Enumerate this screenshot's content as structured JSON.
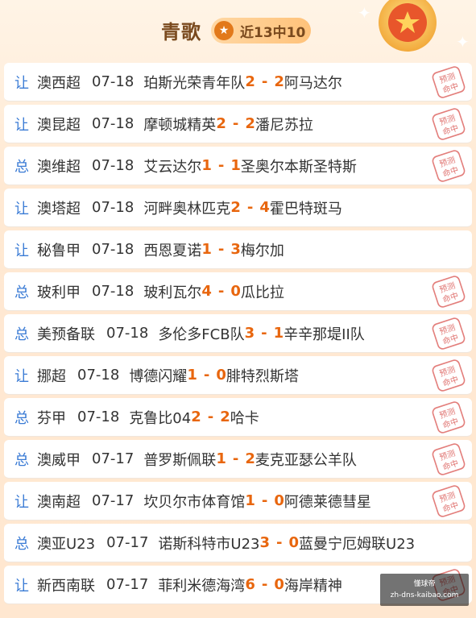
{
  "header": {
    "title": "青歌",
    "record": "近13中10"
  },
  "stamp_text": [
    "预测",
    "命中"
  ],
  "watermark": {
    "line1": "懂球帝",
    "line2": "zh-dns-kaibao.com"
  },
  "colors": {
    "accent": "#e8660e",
    "tag_blue": "#3a7bd5",
    "stamp_red": "#d9534f"
  },
  "matches": [
    {
      "tag": "让",
      "league": "澳西超",
      "date": "07-18",
      "home": "珀斯光荣青年队",
      "home_score": "2",
      "sep": "-",
      "away_score": "2",
      "away": "阿马达尔",
      "hit": true
    },
    {
      "tag": "让",
      "league": "澳昆超",
      "date": "07-18",
      "home": "摩顿城精英",
      "home_score": "2",
      "sep": "-",
      "away_score": "2",
      "away": "潘尼苏拉",
      "hit": true
    },
    {
      "tag": "总",
      "league": "澳维超",
      "date": "07-18",
      "home": "艾云达尔",
      "home_score": "1",
      "sep": "-",
      "away_score": "1",
      "away": "圣奥尔本斯圣特斯",
      "hit": true
    },
    {
      "tag": "让",
      "league": "澳塔超",
      "date": "07-18",
      "home": "河畔奥林匹克",
      "home_score": "2",
      "sep": "-",
      "away_score": "4",
      "away": "霍巴特斑马",
      "hit": false
    },
    {
      "tag": "让",
      "league": "秘鲁甲",
      "date": "07-18",
      "home": "西恩夏诺",
      "home_score": "1",
      "sep": "-",
      "away_score": "3",
      "away": "梅尔加",
      "hit": false
    },
    {
      "tag": "总",
      "league": "玻利甲",
      "date": "07-18",
      "home": "玻利瓦尔",
      "home_score": "4",
      "sep": "-",
      "away_score": "0",
      "away": "瓜比拉",
      "hit": true
    },
    {
      "tag": "总",
      "league": "美预备联",
      "date": "07-18",
      "home": "多伦多FCB队",
      "home_score": "3",
      "sep": "-",
      "away_score": "1",
      "away": "辛辛那堤II队",
      "hit": true
    },
    {
      "tag": "让",
      "league": "挪超",
      "date": "07-18",
      "home": "博德闪耀",
      "home_score": "1",
      "sep": "-",
      "away_score": "0",
      "away": "腓特烈斯塔",
      "hit": true
    },
    {
      "tag": "总",
      "league": "芬甲",
      "date": "07-18",
      "home": "克鲁比04",
      "home_score": "2",
      "sep": "-",
      "away_score": "2",
      "away": "哈卡",
      "hit": true
    },
    {
      "tag": "总",
      "league": "澳威甲",
      "date": "07-17",
      "home": "普罗斯佩联",
      "home_score": "1",
      "sep": "-",
      "away_score": "2",
      "away": "麦克亚瑟公羊队",
      "hit": true
    },
    {
      "tag": "让",
      "league": "澳南超",
      "date": "07-17",
      "home": "坎贝尔市体育馆",
      "home_score": "1",
      "sep": "-",
      "away_score": "0",
      "away": "阿德莱德彗星",
      "hit": true
    },
    {
      "tag": "总",
      "league": "澳亚U23",
      "date": "07-17",
      "home": "诺斯科特市U23",
      "home_score": "3",
      "sep": "-",
      "away_score": "0",
      "away": "蓝曼宁厄姆联U23",
      "hit": false
    },
    {
      "tag": "让",
      "league": "新西南联",
      "date": "07-17",
      "home": "菲利米德海湾",
      "home_score": "6",
      "sep": "-",
      "away_score": "0",
      "away": "海岸精神",
      "hit": true
    }
  ]
}
